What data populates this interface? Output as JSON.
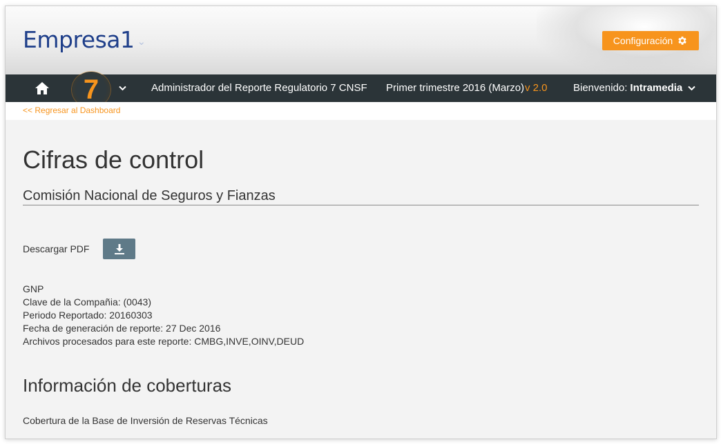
{
  "header": {
    "logo_text": "Empresa1",
    "config_label": "Configuración"
  },
  "navbar": {
    "report_number": "7",
    "admin_title": "Administrador del Reporte Regulatorio 7 CNSF",
    "period": "Primer trimestre 2016 (Marzo)",
    "version": "v 2.0",
    "welcome_label": "Bienvenido:",
    "user": "Intramedia"
  },
  "back_link": "<< Regresar al Dashboard",
  "main": {
    "title": "Cifras de control",
    "subtitle": "Comisión Nacional de Seguros y Fianzas",
    "pdf_label": "Descargar PDF",
    "info": {
      "company": "GNP",
      "company_key": "Clave de la Compañia: (0043)",
      "period_reported": "Periodo Reportado: 20160303",
      "generation_date": "Fecha de generación de reporte: 27 Dec 2016",
      "files": "Archivos procesados para este reporte: CMBG,INVE,OINV,DEUD"
    },
    "section_title": "Información de coberturas",
    "section_item": "Cobertura de la Base de Inversión de Reservas Técnicas"
  },
  "colors": {
    "accent": "#f7941d",
    "navbar_bg": "#2b3438",
    "logo": "#1f3f8a",
    "pdf_button": "#5f7a88"
  },
  "icons": {
    "home": "home-icon",
    "gear": "gear-icon",
    "download": "download-icon",
    "chevron": "chevron-down-icon"
  }
}
